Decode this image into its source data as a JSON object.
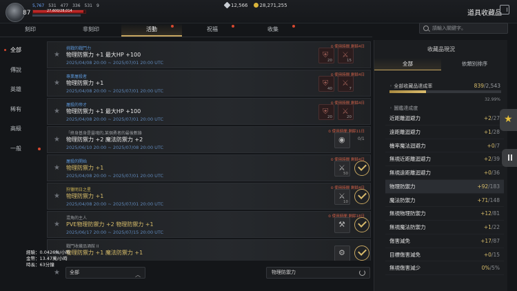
{
  "player": {
    "level": "87",
    "stats": [
      "5,767",
      "531",
      "477",
      "336",
      "531",
      "9"
    ],
    "hp_text": "27,600/28,014"
  },
  "currency": {
    "silver": "12,566",
    "gold": "28,271,255"
  },
  "page_title": "道具收藏品",
  "tabs": [
    {
      "label": "刻印"
    },
    {
      "label": "非刻印"
    },
    {
      "label": "活動"
    },
    {
      "label": "祝福"
    },
    {
      "label": "收集"
    }
  ],
  "search": {
    "placeholder": "請輸入關鍵字。"
  },
  "sidenav": {
    "items": [
      {
        "label": "全部"
      },
      {
        "label": "傳說"
      },
      {
        "label": "英雄"
      },
      {
        "label": "稀有"
      },
      {
        "label": "高級"
      },
      {
        "label": "一般"
      }
    ]
  },
  "items": [
    {
      "category": "挑戰的戰鬥力",
      "name": "物理防禦力 +1 最大HP +100",
      "period": "2025/04/08 20:00 ~ 2025/07/01 20:00 UTC",
      "limit": "使用時間 剩餘4日",
      "slot1": "20",
      "slot2": "15"
    },
    {
      "category": "專業屠殺者",
      "name": "物理防禦力 +1",
      "period": "2025/04/08 20:00 ~ 2025/07/01 20:00 UTC",
      "limit": "使用時間 剩餘4日",
      "slot1": "40",
      "slot2": "7"
    },
    {
      "category": "屠殺的帝才",
      "name": "物理防禦力 +1 最大HP +100",
      "period": "2025/04/08 20:00 ~ 2025/07/01 20:00 UTC",
      "limit": "使用時間 剩餘4日",
      "slot1": "20",
      "slot2": "20"
    },
    {
      "category": "「終身基身是靈魂的,某個勇者的最後數錄",
      "name": "物理防禦力 +2 魔法防禦力 +2",
      "period": "2025/06/10 20:00 ~ 2025/07/08 20:00 UTC",
      "limit": "使用時間 剩餘11日",
      "progress": "0/1"
    },
    {
      "category": "屠殺的開始",
      "name": "物理防禦力 +1",
      "period": "2025/04/08 20:00 ~ 2025/07/01 20:00 UTC",
      "limit": "使用時間 剩餘4日",
      "slot1": "50"
    },
    {
      "category": "狩獵明日之星",
      "name": "物理防禦力 +1",
      "period": "2025/04/08 20:00 ~ 2025/07/01 20:00 UTC",
      "limit": "使用時間 剩餘4日",
      "slot1": "10"
    },
    {
      "category": "混角的主人",
      "name": "PVE物理防禦力 +2 物理防禦力 +1",
      "period": "2025/06/17 20:00 ~ 2025/07/15 20:00 UTC",
      "limit": "使用時間 剩餘18日"
    },
    {
      "category": "戰鬥收藏品酒館 II",
      "name": "物理防禦力 +1 魔法防禦力 +1",
      "period": "",
      "limit": ""
    }
  ],
  "bottom": {
    "filter_value": "全部",
    "sort_value": "物理防禦力"
  },
  "overlay": {
    "exp": "經驗：0.0426%/小時",
    "gold": "金幣：13.47萬/小時",
    "time": "時長：63分鐘"
  },
  "panel": {
    "title": "收藏品現況",
    "tab_all": "全部",
    "tab_effect": "依類別排序",
    "total_label": "全部收藏品達成率",
    "total_done": "839",
    "total_max": "/2,543",
    "total_progress": 0.3299,
    "total_pct": "32.99%",
    "group_label": "圖鑑達成度",
    "rows": [
      {
        "label": "近距離迴避力",
        "value": "+2",
        "max": "/27"
      },
      {
        "label": "遠距離迴避力",
        "value": "+1",
        "max": "/28"
      },
      {
        "label": "機率魔法迴避力",
        "value": "+0",
        "max": "/7"
      },
      {
        "label": "無視近距離迴避力",
        "value": "+2",
        "max": "/39"
      },
      {
        "label": "無視遠距離迴避力",
        "value": "+0",
        "max": "/36"
      },
      {
        "label": "物理防禦力",
        "value": "+92",
        "max": "/183"
      },
      {
        "label": "魔法防禦力",
        "value": "+71",
        "max": "/148"
      },
      {
        "label": "無視物理防禦力",
        "value": "+12",
        "max": "/81"
      },
      {
        "label": "無視魔法防禦力",
        "value": "+1",
        "max": "/22"
      },
      {
        "label": "傷害減免",
        "value": "+17",
        "max": "/87"
      },
      {
        "label": "目標傷害減免",
        "value": "+0",
        "max": "/15"
      },
      {
        "label": "無視傷害減少",
        "value": "0%",
        "max": "/5%"
      }
    ]
  },
  "colors": {
    "accent_gold": "#c9a861",
    "alert_red": "#d6482f",
    "category_blue": "#5b95d6"
  }
}
